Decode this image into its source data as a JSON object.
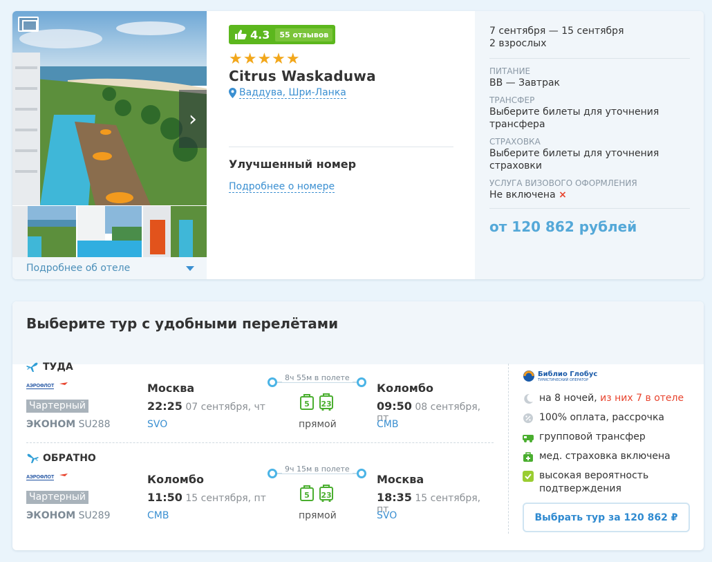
{
  "hotel": {
    "rating": "4.3",
    "reviews": "55 отзывов",
    "stars": "★★★★★",
    "name": "Citrus Waskaduwa",
    "location": "Ваддува, Шри-Ланка",
    "more_hotel": "Подробнее об отеле",
    "room_title": "Улучшенный номер",
    "room_link": "Подробнее о номере"
  },
  "summary": {
    "dates": "7 сентября — 15 сентября",
    "guests": "2 взрослых",
    "meal_label": "ПИТАНИЕ",
    "meal_value": "BB — Завтрак",
    "transfer_label": "ТРАНСФЕР",
    "transfer_value": "Выберите билеты для уточнения трансфера",
    "insurance_label": "СТРАХОВКА",
    "insurance_value": "Выберите билеты для уточнения страховки",
    "visa_label": "УСЛУГА ВИЗОВОГО ОФОРМЛЕНИЯ",
    "visa_value": "Не включена",
    "visa_mark": "×",
    "price": "от 120 862 рублей"
  },
  "flights_section": {
    "title": "Выберите тур с удобными перелётами",
    "outbound": {
      "direction": "ТУДА",
      "airline": "АЭРОФЛОТ",
      "type": "Чартерный",
      "class": "ЭКОНОМ",
      "flight_no": "SU288",
      "from_city": "Москва",
      "dep_time": "22:25",
      "dep_date": "07 сентября, чт",
      "from_code": "SVO",
      "duration": "8ч 55м в полете",
      "bag1": "5",
      "bag2": "23",
      "stops": "прямой",
      "to_city": "Коломбо",
      "arr_time": "09:50",
      "arr_date": "08 сентября, пт",
      "to_code": "CMB"
    },
    "return": {
      "direction": "ОБРАТНО",
      "airline": "АЭРОФЛОТ",
      "type": "Чартерный",
      "class": "ЭКОНОМ",
      "flight_no": "SU289",
      "from_city": "Коломбо",
      "dep_time": "11:50",
      "dep_date": "15 сентября, пт",
      "from_code": "CMB",
      "duration": "9ч 15м в полете",
      "bag1": "5",
      "bag2": "23",
      "stops": "прямой",
      "to_city": "Москва",
      "arr_time": "18:35",
      "arr_date": "15 сентября, пт",
      "to_code": "SVO"
    },
    "operator": {
      "name": "Библио Глобус",
      "subtitle": "ТУРИСТИЧЕСКИЙ ОПЕРАТОР"
    },
    "features": {
      "nights": "на 8 ночей, ",
      "nights_hotel": "из них 7 в отеле",
      "payment": "100% оплата, рассрочка",
      "transfer": "групповой трансфер",
      "insurance": "мед. страховка включена",
      "confirmation": "высокая вероятность подтверждения"
    },
    "choose_button": "Выбрать тур за 120 862 ₽"
  },
  "colors": {
    "accent": "#3a8fd1",
    "rating_green": "#5cb71d",
    "star": "#f2a71b",
    "price": "#54a8d8",
    "warning": "#e8442e"
  }
}
